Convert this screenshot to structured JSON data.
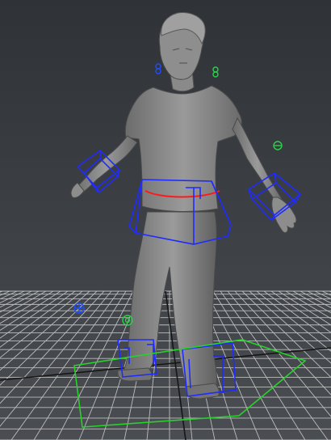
{
  "viewport": {
    "panel": "",
    "background_top": "#2f3337",
    "background_bottom": "#4a4d52",
    "grid_color": "#c9c9c9",
    "grid_axis_color": "#111111",
    "model_color": "#7b7b7b",
    "control_colors": {
      "ik_box": "#1f2bff",
      "waist_ring": "#ff1a1a",
      "root_control": "#28d228",
      "locator_blue": "#1f4dff",
      "locator_green": "#2ad24a"
    }
  },
  "scene": {
    "model": "character-mesh",
    "controls": [
      "left-arm-ik-box",
      "right-arm-ik-box",
      "hip-control-box",
      "waist-ring",
      "left-foot-ik-box",
      "right-foot-ik-box",
      "root-control-curve",
      "head-locator-left",
      "head-locator-right",
      "wrist-locator",
      "ground-locator-blue",
      "ground-locator-green"
    ]
  }
}
